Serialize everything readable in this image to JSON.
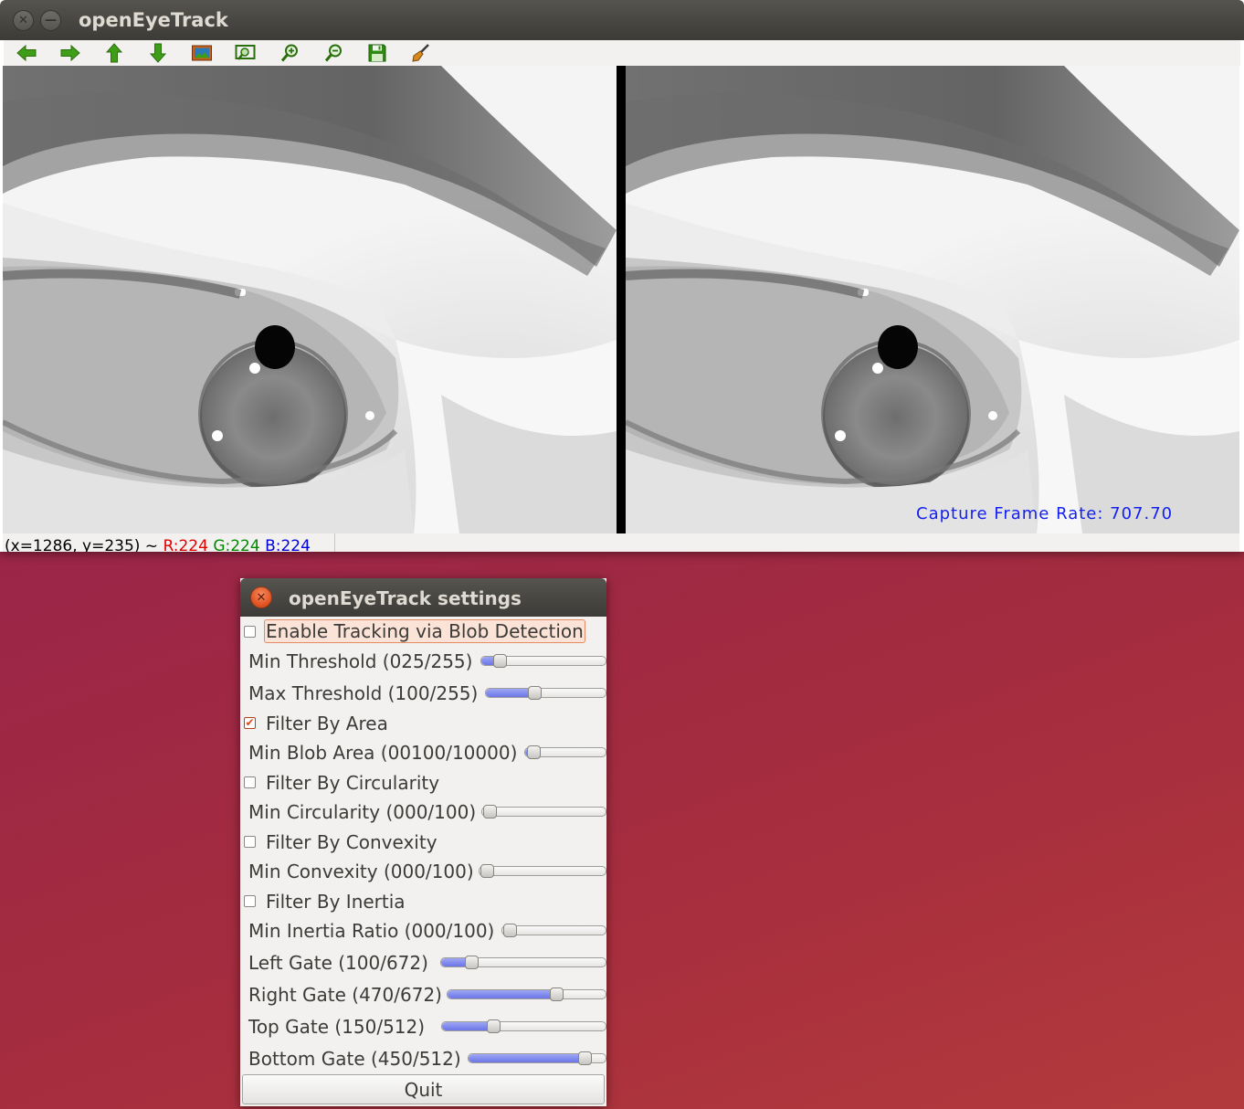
{
  "main_window": {
    "title": "openEyeTrack",
    "toolbar": {
      "tools": [
        {
          "icon": "arrow-left-icon",
          "color": "#3f9e17"
        },
        {
          "icon": "arrow-right-icon",
          "color": "#3f9e17"
        },
        {
          "icon": "arrow-up-icon",
          "color": "#3f9e17"
        },
        {
          "icon": "arrow-down-icon",
          "color": "#3f9e17"
        },
        {
          "icon": "image-icon"
        },
        {
          "icon": "zoom-fit-icon"
        },
        {
          "icon": "zoom-in-icon"
        },
        {
          "icon": "zoom-out-icon"
        },
        {
          "icon": "save-icon"
        },
        {
          "icon": "brush-icon"
        }
      ]
    },
    "overlay": {
      "frame_rate_text": "Capture Frame Rate: 707.70",
      "frame_rate_color": "#1420f0"
    },
    "status": {
      "coords": "(x=1286, y=235) ~ ",
      "r": "R:224",
      "g": "G:224",
      "b": "B:224",
      "r_color": "#e00000",
      "g_color": "#008a00",
      "b_color": "#0000dd"
    }
  },
  "settings_window": {
    "title": "openEyeTrack settings",
    "controls": [
      {
        "type": "checkbox",
        "label": "Enable Tracking via Blob Detection",
        "checked": false,
        "highlighted": true
      },
      {
        "type": "slider",
        "label": "Min Threshold (025/255)",
        "value": 25,
        "max": 255
      },
      {
        "type": "slider",
        "label": "Max Threshold (100/255)",
        "value": 100,
        "max": 255
      },
      {
        "type": "checkbox",
        "label": "Filter By Area",
        "checked": true
      },
      {
        "type": "slider",
        "label": "Min Blob Area (00100/10000)",
        "value": 100,
        "max": 10000
      },
      {
        "type": "checkbox",
        "label": "Filter By Circularity",
        "checked": false
      },
      {
        "type": "slider",
        "label": "Min Circularity (000/100)",
        "value": 0,
        "max": 100
      },
      {
        "type": "checkbox",
        "label": "Filter By Convexity",
        "checked": false
      },
      {
        "type": "slider",
        "label": "Min Convexity (000/100)",
        "value": 0,
        "max": 100
      },
      {
        "type": "checkbox",
        "label": "Filter By Inertia",
        "checked": false
      },
      {
        "type": "slider",
        "label": "Min Inertia Ratio (000/100)",
        "value": 0,
        "max": 100
      },
      {
        "type": "slider",
        "label": "Left Gate  (100/672)",
        "value": 100,
        "max": 672
      },
      {
        "type": "slider",
        "label": "Right Gate (470/672)",
        "value": 470,
        "max": 672
      },
      {
        "type": "slider",
        "label": "Top Gate   (150/512)",
        "value": 150,
        "max": 512
      },
      {
        "type": "slider",
        "label": "Bottom Gate (450/512)",
        "value": 450,
        "max": 512
      }
    ],
    "quit_label": "Quit",
    "accent_color": "#dd4814"
  }
}
